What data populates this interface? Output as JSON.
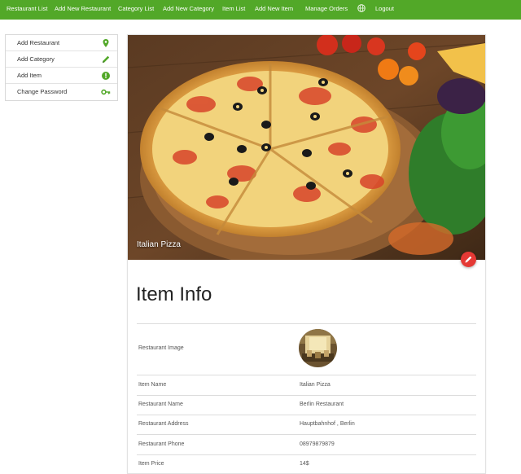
{
  "nav": {
    "items": [
      "Restaurant List",
      "Add New Restaurant",
      "Category List",
      "Add New Category",
      "Item List",
      "Add New Item",
      "Manage Orders"
    ],
    "logout": "Logout",
    "globe_icon": "globe-icon",
    "bar_color": "#52a828"
  },
  "sidebar": {
    "items": [
      {
        "label": "Add Restaurant",
        "icon": "map-pin-icon"
      },
      {
        "label": "Add Category",
        "icon": "pencil-icon"
      },
      {
        "label": "Add Item",
        "icon": "alert-circle-icon"
      },
      {
        "label": "Change Password",
        "icon": "key-icon"
      }
    ],
    "icon_color": "#52a828"
  },
  "item": {
    "caption": "Italian Pizza",
    "title": "Item Info",
    "fab_icon": "pencil-icon",
    "fab_color": "#e53935",
    "rows": [
      {
        "label": "Restaurant Image",
        "value": ""
      },
      {
        "label": "Item Name",
        "value": "Italian Pizza"
      },
      {
        "label": "Restaurant Name",
        "value": "Berlin Restaurant"
      },
      {
        "label": "Restaurant Address",
        "value": "Hauptbahnhof , Berlin"
      },
      {
        "label": "Restaurant Phone",
        "value": "08979879879"
      },
      {
        "label": "Item Price",
        "value": "14$"
      }
    ]
  }
}
